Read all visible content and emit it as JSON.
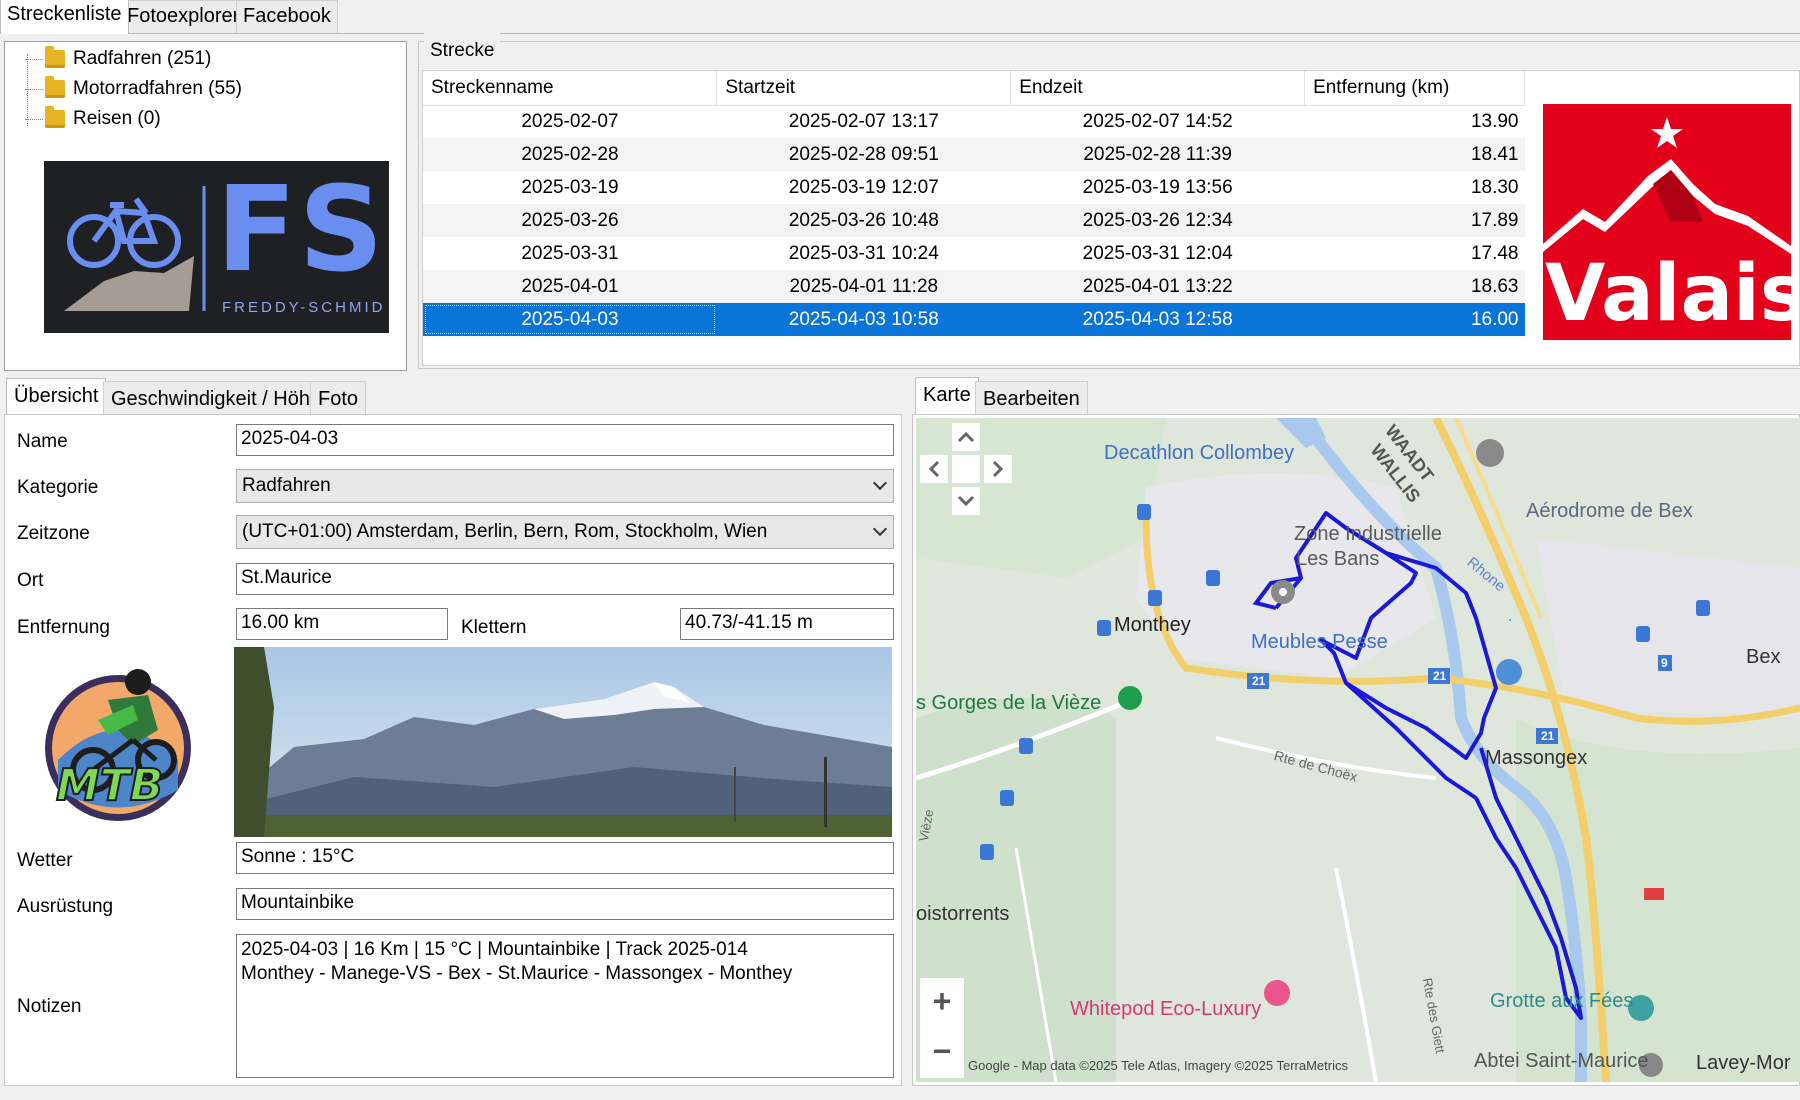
{
  "top_tabs": [
    "Streckenliste",
    "Fotoexplorer",
    "Facebook"
  ],
  "tree": [
    {
      "label": "Radfahren (251)"
    },
    {
      "label": "Motorradfahren (55)"
    },
    {
      "label": "Reisen (0)"
    }
  ],
  "logo_fs": {
    "letters": "FS",
    "caption": "FREDDY-SCHMID"
  },
  "valais_logo": {
    "text": "Valais"
  },
  "routes": {
    "group_title": "Strecke",
    "columns": [
      "Streckenname",
      "Startzeit",
      "Endzeit",
      "Entfernung (km)"
    ],
    "rows": [
      {
        "name": "2025-02-07",
        "start": "2025-02-07 13:17",
        "end": "2025-02-07 14:52",
        "dist": "13.90"
      },
      {
        "name": "2025-02-28",
        "start": "2025-02-28 09:51",
        "end": "2025-02-28 11:39",
        "dist": "18.41"
      },
      {
        "name": "2025-03-19",
        "start": "2025-03-19 12:07",
        "end": "2025-03-19 13:56",
        "dist": "18.30"
      },
      {
        "name": "2025-03-26",
        "start": "2025-03-26 10:48",
        "end": "2025-03-26 12:34",
        "dist": "17.89"
      },
      {
        "name": "2025-03-31",
        "start": "2025-03-31 10:24",
        "end": "2025-03-31 12:04",
        "dist": "17.48"
      },
      {
        "name": "2025-04-01",
        "start": "2025-04-01 11:28",
        "end": "2025-04-01 13:22",
        "dist": "18.63"
      },
      {
        "name": "2025-04-03",
        "start": "2025-04-03 10:58",
        "end": "2025-04-03 12:58",
        "dist": "16.00"
      }
    ],
    "selected_index": 6
  },
  "detail_tabs": [
    "Übersicht",
    "Geschwindigkeit / Höhe",
    "Foto"
  ],
  "form": {
    "name_label": "Name",
    "name_value": "2025-04-03",
    "category_label": "Kategorie",
    "category_value": "Radfahren",
    "timezone_label": "Zeitzone",
    "timezone_value": "(UTC+01:00) Amsterdam, Berlin, Bern, Rom, Stockholm, Wien",
    "place_label": "Ort",
    "place_value": "St.Maurice",
    "distance_label": "Entfernung",
    "distance_value": "16.00 km",
    "climb_label": "Klettern",
    "climb_value": "40.73/-41.15 m",
    "weather_label": "Wetter",
    "weather_value": "Sonne  :  15°C",
    "equipment_label": "Ausrüstung",
    "equipment_value": "Mountainbike",
    "notes_label": "Notizen",
    "notes_line1": "2025-04-03  |  16 Km  |  15 °C  |  Mountainbike  |  Track 2025-014",
    "notes_line2": "Monthey - Manege-VS - Bex - St.Maurice - Massongex - Monthey"
  },
  "mtb_logo": {
    "text": "MTB"
  },
  "map_tabs": [
    "Karte",
    "Bearbeiten"
  ],
  "map": {
    "labels": {
      "decathlon": "Decathlon Collombey",
      "waadt": "WAADT",
      "wallis": "WALLIS",
      "aerodrome": "Aérodrome de Bex",
      "zone": "Zone Industrielle",
      "lesbans": "Les Bans",
      "monthey": "Monthey",
      "meubles": "Meubles Pesse",
      "rhone": "Rhone",
      "bex": "Bex",
      "gorges": "s Gorges de la Vièze",
      "massongex": "Massongex",
      "rtechoex": "Rte de Choëx",
      "troistorrents": "oistorrents",
      "whitepod": "Whitepod Eco-Luxury",
      "grotte": "Grotte aux Fées",
      "abtei": "Abtei Saint-Maurice",
      "lavey": "Lavey-Mor",
      "rtedesgiet": "Rte des Giett",
      "vieze": "Vièze",
      "road21a": "21",
      "road21b": "21",
      "road21c": "21",
      "road9": "9",
      "copyright": "Google - Map data ©2025 Tele Atlas, Imagery ©2025 TerraMetrics"
    },
    "zoom_in": "+",
    "zoom_out": "−"
  },
  "colors": {
    "selection": "#0a74d9",
    "route": "#1a1ad6",
    "valais_red": "#e2001a"
  }
}
